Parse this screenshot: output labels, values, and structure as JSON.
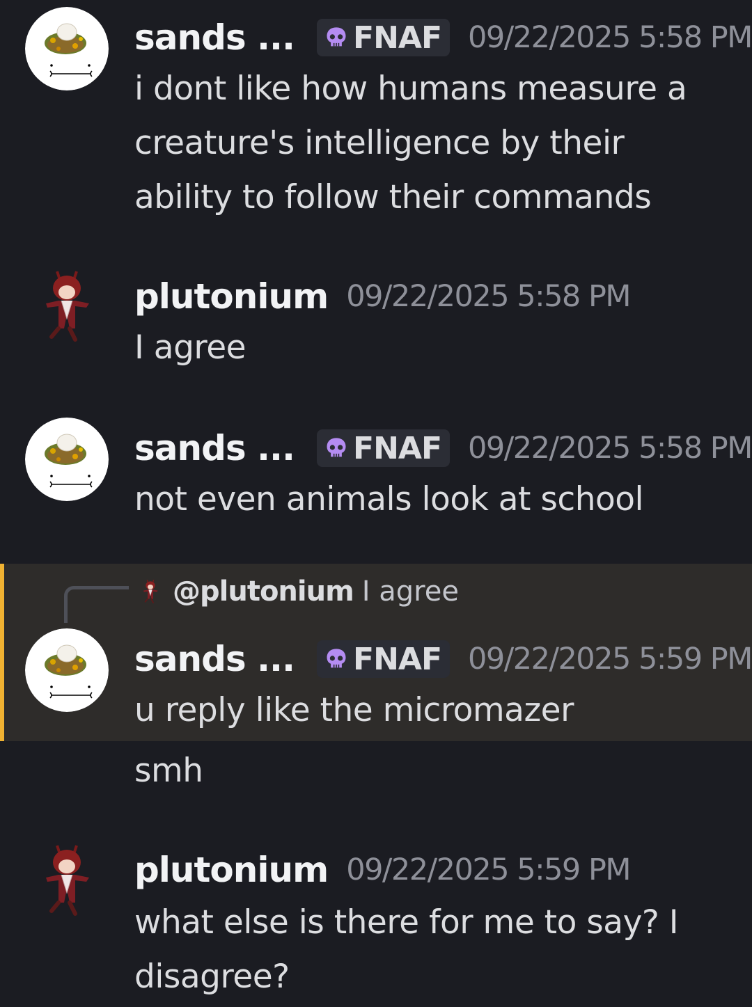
{
  "messages": [
    {
      "username": "sands ...",
      "tag": {
        "icon": "skull-icon",
        "label": "FNAF",
        "color": "#a77ce9"
      },
      "timestamp": "09/22/2025 5:58 PM",
      "lines": [
        "i dont like how humans measure a",
        "creature's intelligence by their",
        "ability to follow their commands"
      ]
    },
    {
      "username": "plutonium",
      "timestamp": "09/22/2025 5:58 PM",
      "lines": [
        "I agree"
      ]
    },
    {
      "username": "sands ...",
      "tag": {
        "icon": "skull-icon",
        "label": "FNAF",
        "color": "#a77ce9"
      },
      "timestamp": "09/22/2025 5:58 PM",
      "lines": [
        "not even animals look at school"
      ]
    },
    {
      "reply_to": {
        "mention": "@plutonium",
        "text": "I agree"
      },
      "username": "sands ...",
      "tag": {
        "icon": "skull-icon",
        "label": "FNAF",
        "color": "#a77ce9"
      },
      "timestamp": "09/22/2025 5:59 PM",
      "lines": [
        "u reply like the micromazer"
      ],
      "highlight_color": "#f0b232"
    },
    {
      "lines": [
        "smh"
      ]
    },
    {
      "username": "plutonium",
      "timestamp": "09/22/2025 5:59 PM",
      "lines": [
        "what else is there for me to say? I",
        "disagree?"
      ]
    }
  ]
}
